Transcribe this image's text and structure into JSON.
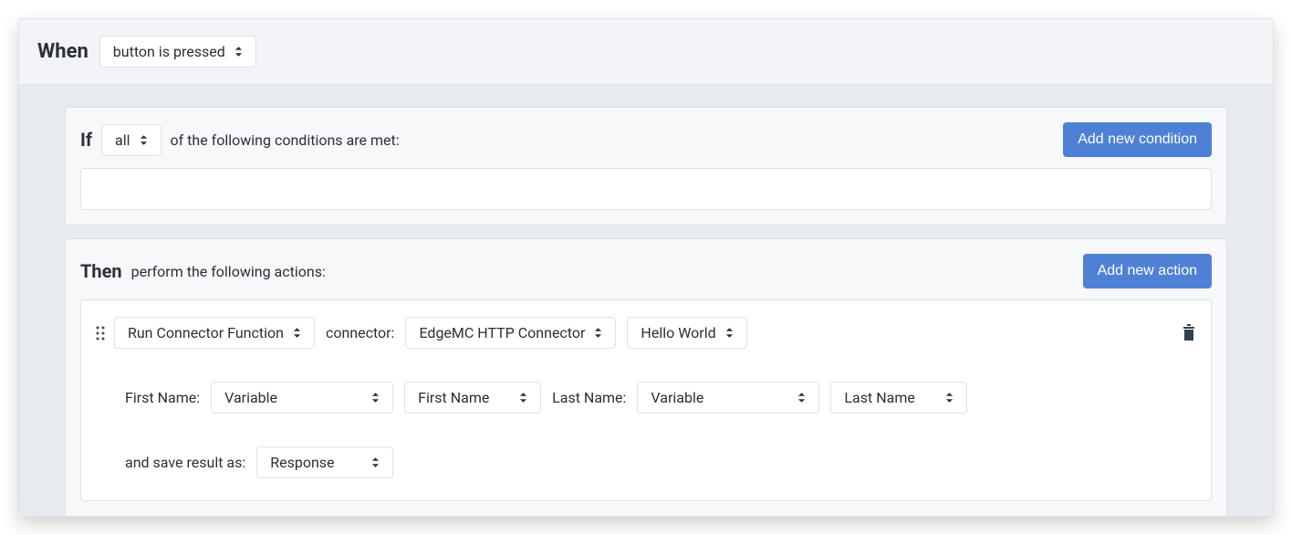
{
  "when": {
    "label": "When",
    "trigger": "button is pressed"
  },
  "if": {
    "label": "If",
    "quantifier": "all",
    "suffix_text": "of the following conditions are met:",
    "add_button": "Add new condition"
  },
  "then": {
    "label": "Then",
    "suffix_text": "perform the following actions:",
    "add_button": "Add new action"
  },
  "action": {
    "type": "Run Connector Function",
    "connector_label": "connector:",
    "connector": "EdgeMC HTTP Connector",
    "function": "Hello World",
    "params": {
      "first_name_label": "First Name:",
      "first_name_mode": "Variable",
      "first_name_value": "First Name",
      "last_name_label": "Last Name:",
      "last_name_mode": "Variable",
      "last_name_value": "Last Name"
    },
    "save_label": "and save result as:",
    "save_value": "Response"
  }
}
